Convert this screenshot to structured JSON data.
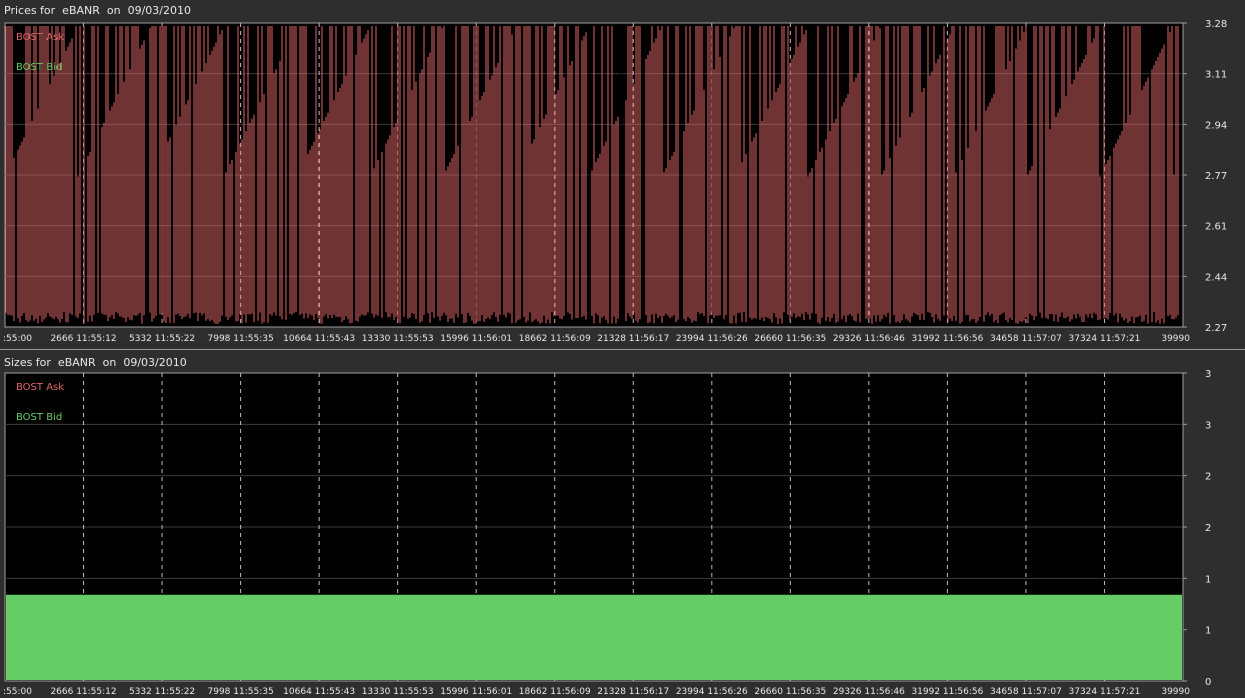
{
  "chart_data": [
    {
      "type": "line",
      "title": "Prices for  eBANR  on  09/03/2010",
      "series": [
        {
          "name": "BOST Ask",
          "color": "#e06666"
        },
        {
          "name": "BOST Bid",
          "color": "#66cc66"
        }
      ],
      "yticks": [
        "3.28",
        "3.11",
        "2.94",
        "2.77",
        "2.61",
        "2.44",
        "2.27"
      ],
      "ylim": [
        2.27,
        3.28
      ],
      "xticks": [
        ":55:00",
        "2666 11:55:12",
        "5332 11:55:22",
        "7998 11:55:35",
        "10664 11:55:43",
        "13330 11:55:53",
        "15996 11:56:01",
        "18662 11:56:09",
        "21328 11:56:17",
        "23994 11:56:26",
        "26660 11:56:35",
        "29326 11:56:46",
        "31992 11:56:56",
        "34658 11:57:07",
        "37324 11:57:21",
        "39990"
      ],
      "xlim": [
        0,
        39990
      ],
      "legend": "top-left",
      "grid": true
    },
    {
      "type": "area",
      "title": "Sizes for  eBANR  on  09/03/2010",
      "series": [
        {
          "name": "BOST Ask",
          "color": "#e06666"
        },
        {
          "name": "BOST Bid",
          "color": "#66cc66",
          "values": [
            1,
            1
          ]
        }
      ],
      "x": [
        0,
        39990
      ],
      "yticks": [
        "3",
        "3",
        "2",
        "2",
        "1",
        "1",
        "0"
      ],
      "xticks": [
        ":55:00",
        "2666 11:55:12",
        "5332 11:55:22",
        "7998 11:55:35",
        "10664 11:55:43",
        "13330 11:55:53",
        "15996 11:56:01",
        "18662 11:56:09",
        "21328 11:56:17",
        "23994 11:56:26",
        "26660 11:56:35",
        "29326 11:56:46",
        "31992 11:56:56",
        "34658 11:57:07",
        "37324 11:57:21",
        "39990"
      ],
      "xlim": [
        0,
        39990
      ],
      "legend": "top-left",
      "grid": true
    }
  ]
}
